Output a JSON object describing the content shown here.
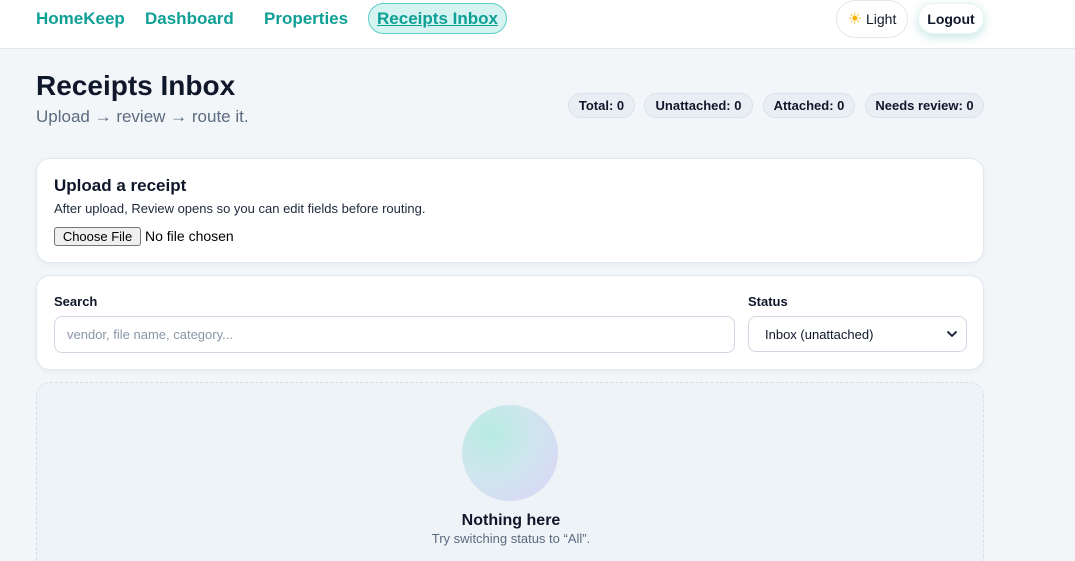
{
  "nav": {
    "brand": "HomeKeep",
    "links": [
      "Dashboard",
      "Properties"
    ],
    "active": "Receipts Inbox",
    "theme_icon": "sun-icon",
    "theme_label": "Light",
    "logout_label": "Logout"
  },
  "header": {
    "title": "Receipts Inbox",
    "subtitle": "Upload → review → route it."
  },
  "stats": [
    {
      "label": "Total: 0"
    },
    {
      "label": "Unattached: 0"
    },
    {
      "label": "Attached: 0"
    },
    {
      "label": "Needs review: 0"
    }
  ],
  "upload": {
    "title": "Upload a receipt",
    "hint": "After upload, Review opens so you can edit fields before routing.",
    "button_label": "Choose File",
    "file_status": "No file chosen"
  },
  "filters": {
    "search_label": "Search",
    "search_placeholder": "vendor, file name, category...",
    "search_value": "",
    "status_label": "Status",
    "status_selected": "Inbox (unattached)"
  },
  "empty_state": {
    "title": "Nothing here",
    "message": "Try switching status to “All”."
  },
  "colors": {
    "accent": "#0e9f95",
    "background": "#f3f6f8"
  }
}
